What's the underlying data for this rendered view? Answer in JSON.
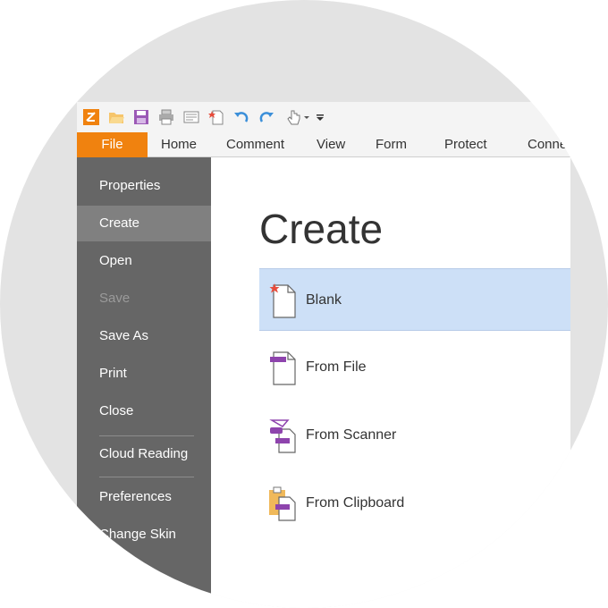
{
  "quick_access": {
    "icons": [
      "app-logo-icon",
      "open-folder-icon",
      "save-icon",
      "print-icon",
      "scan-icon",
      "new-blank-icon",
      "undo-icon",
      "redo-icon",
      "hand-tool-icon",
      "customize-dropdown-icon"
    ],
    "accent": "#f0820f"
  },
  "ribbon": {
    "tabs": [
      {
        "label": "File"
      },
      {
        "label": "Home"
      },
      {
        "label": "Comment"
      },
      {
        "label": "View"
      },
      {
        "label": "Form"
      },
      {
        "label": "Protect"
      },
      {
        "label": "Conne"
      }
    ],
    "active_tab": "File"
  },
  "sidebar": {
    "items": [
      {
        "label": "Properties"
      },
      {
        "label": "Create"
      },
      {
        "label": "Open"
      },
      {
        "label": "Save"
      },
      {
        "label": "Save As"
      },
      {
        "label": "Print"
      },
      {
        "label": "Close"
      },
      {
        "label": "Cloud Reading"
      },
      {
        "label": "Preferences"
      },
      {
        "label": "Change Skin"
      }
    ],
    "active_item": "Create",
    "disabled_item": "Save"
  },
  "main": {
    "title": "Create",
    "options": [
      {
        "label": "Blank",
        "icon": "blank-document-icon"
      },
      {
        "label": "From File",
        "icon": "from-file-icon"
      },
      {
        "label": "From Scanner",
        "icon": "from-scanner-icon"
      },
      {
        "label": "From Clipboard",
        "icon": "from-clipboard-icon"
      }
    ],
    "selected_option": "Blank",
    "selected_color": "#cde0f7"
  }
}
